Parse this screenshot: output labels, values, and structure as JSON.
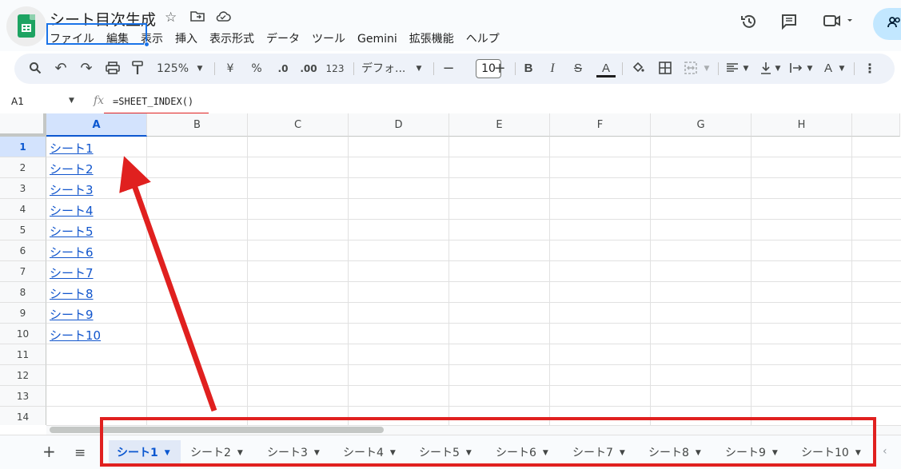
{
  "app": {
    "doc_title": "シート目次生成",
    "menu": [
      "ファイル",
      "編集",
      "表示",
      "挿入",
      "表示形式",
      "データ",
      "ツール",
      "Gemini",
      "拡張機能",
      "ヘルプ"
    ]
  },
  "toolbar": {
    "zoom": "125%",
    "currency": "¥",
    "percent": "%",
    "dec_less": ".0",
    "dec_more": ".00",
    "number_format": "123",
    "font": "デフォ...",
    "font_size": "10"
  },
  "formula_bar": {
    "cell_ref": "A1",
    "fx": "fx",
    "formula": "=SHEET_INDEX()"
  },
  "grid": {
    "columns": [
      "A",
      "B",
      "C",
      "D",
      "E",
      "F",
      "G",
      "H"
    ],
    "rows": [
      "1",
      "2",
      "3",
      "4",
      "5",
      "6",
      "7",
      "8",
      "9",
      "10",
      "11",
      "12",
      "13",
      "14"
    ],
    "column_a_values": [
      "シート1",
      "シート2",
      "シート3",
      "シート4",
      "シート5",
      "シート6",
      "シート7",
      "シート8",
      "シート9",
      "シート10"
    ]
  },
  "sheet_tabs": {
    "tabs": [
      "シート1",
      "シート2",
      "シート3",
      "シート4",
      "シート5",
      "シート6",
      "シート7",
      "シート8",
      "シート9",
      "シート10"
    ],
    "active_index": 0
  },
  "colors": {
    "link": "#1155cc",
    "selection": "#1a73e8",
    "annotation_red": "#e0201f",
    "sheets_green": "#1ea362"
  }
}
